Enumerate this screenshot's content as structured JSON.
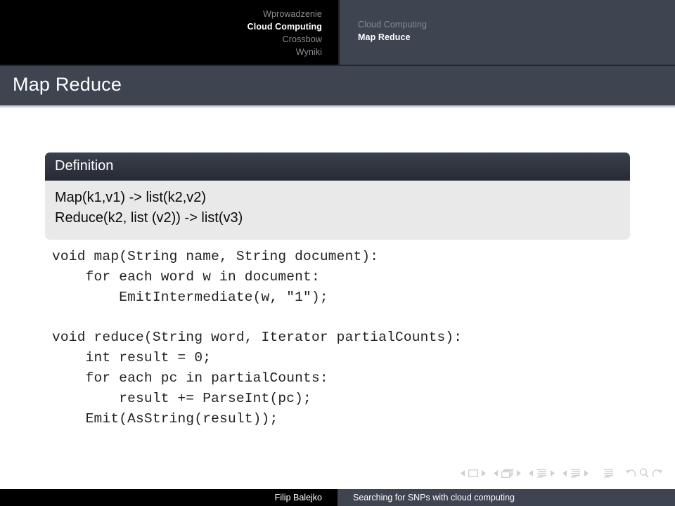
{
  "header": {
    "sections": [
      {
        "label": "Wprowadzenie",
        "active": false
      },
      {
        "label": "Cloud Computing",
        "active": true
      },
      {
        "label": "Crossbow",
        "active": false
      },
      {
        "label": "Wyniki",
        "active": false
      }
    ],
    "subsections": [
      {
        "label": "Cloud Computing",
        "active": false
      },
      {
        "label": "Map Reduce",
        "active": true
      }
    ]
  },
  "slide": {
    "title": "Map Reduce"
  },
  "block": {
    "title": "Definition",
    "lines": [
      "Map(k1,v1) -> list(k2,v2)",
      "Reduce(k2, list (v2)) -> list(v3)"
    ]
  },
  "code": {
    "map": "void map(String name, String document):\n    for each word w in document:\n        EmitIntermediate(w, \"1\");",
    "reduce": "void reduce(String word, Iterator partialCounts):\n    int result = 0;\n    for each pc in partialCounts:\n        result += ParseInt(pc);\n    Emit(AsString(result));"
  },
  "navigation_symbols": {
    "icons": [
      "slide-prev-icon",
      "slide-current-icon",
      "slide-next-icon",
      "frame-prev-icon",
      "frame-current-icon",
      "frame-next-icon",
      "subsection-prev-icon",
      "subsection-current-icon",
      "subsection-next-icon",
      "section-prev-icon",
      "section-current-icon",
      "section-next-icon",
      "presentation-icon",
      "back-icon",
      "search-icon",
      "forward-icon"
    ]
  },
  "footer": {
    "author": "Filip Balejko",
    "title": "Searching for SNPs with cloud computing"
  },
  "colors": {
    "nav_black": "#000000",
    "slate": "#3e4450",
    "block_title_dark": "#2f343e",
    "block_body_gray": "#e9e9e9",
    "white": "#ffffff"
  }
}
